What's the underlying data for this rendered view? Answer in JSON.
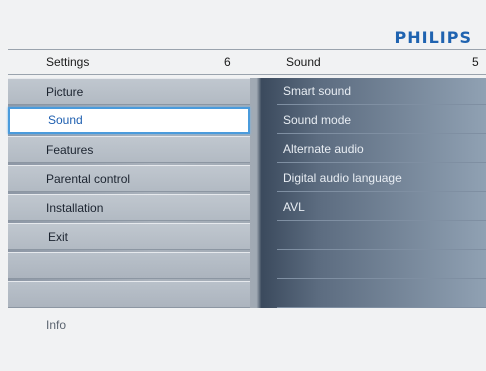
{
  "brand": "PHILIPS",
  "left_header": {
    "title": "Settings",
    "count": "6"
  },
  "right_header": {
    "title": "Sound",
    "count": "5"
  },
  "left_menu": [
    {
      "label": "Picture",
      "selected": false
    },
    {
      "label": "Sound",
      "selected": true
    },
    {
      "label": "Features",
      "selected": false
    },
    {
      "label": "Parental control",
      "selected": false
    },
    {
      "label": "Installation",
      "selected": false
    },
    {
      "label": "Exit",
      "selected": false
    },
    {
      "label": "",
      "selected": false
    },
    {
      "label": "",
      "selected": false
    }
  ],
  "right_menu": [
    {
      "label": "Smart sound"
    },
    {
      "label": "Sound mode"
    },
    {
      "label": "Alternate audio"
    },
    {
      "label": "Digital audio language"
    },
    {
      "label": "AVL"
    },
    {
      "label": ""
    },
    {
      "label": ""
    },
    {
      "label": ""
    }
  ],
  "info_label": "Info",
  "colors": {
    "brand": "#1f63b0",
    "selection_border": "#4a9bdc",
    "selected_text": "#1e5fb0"
  }
}
